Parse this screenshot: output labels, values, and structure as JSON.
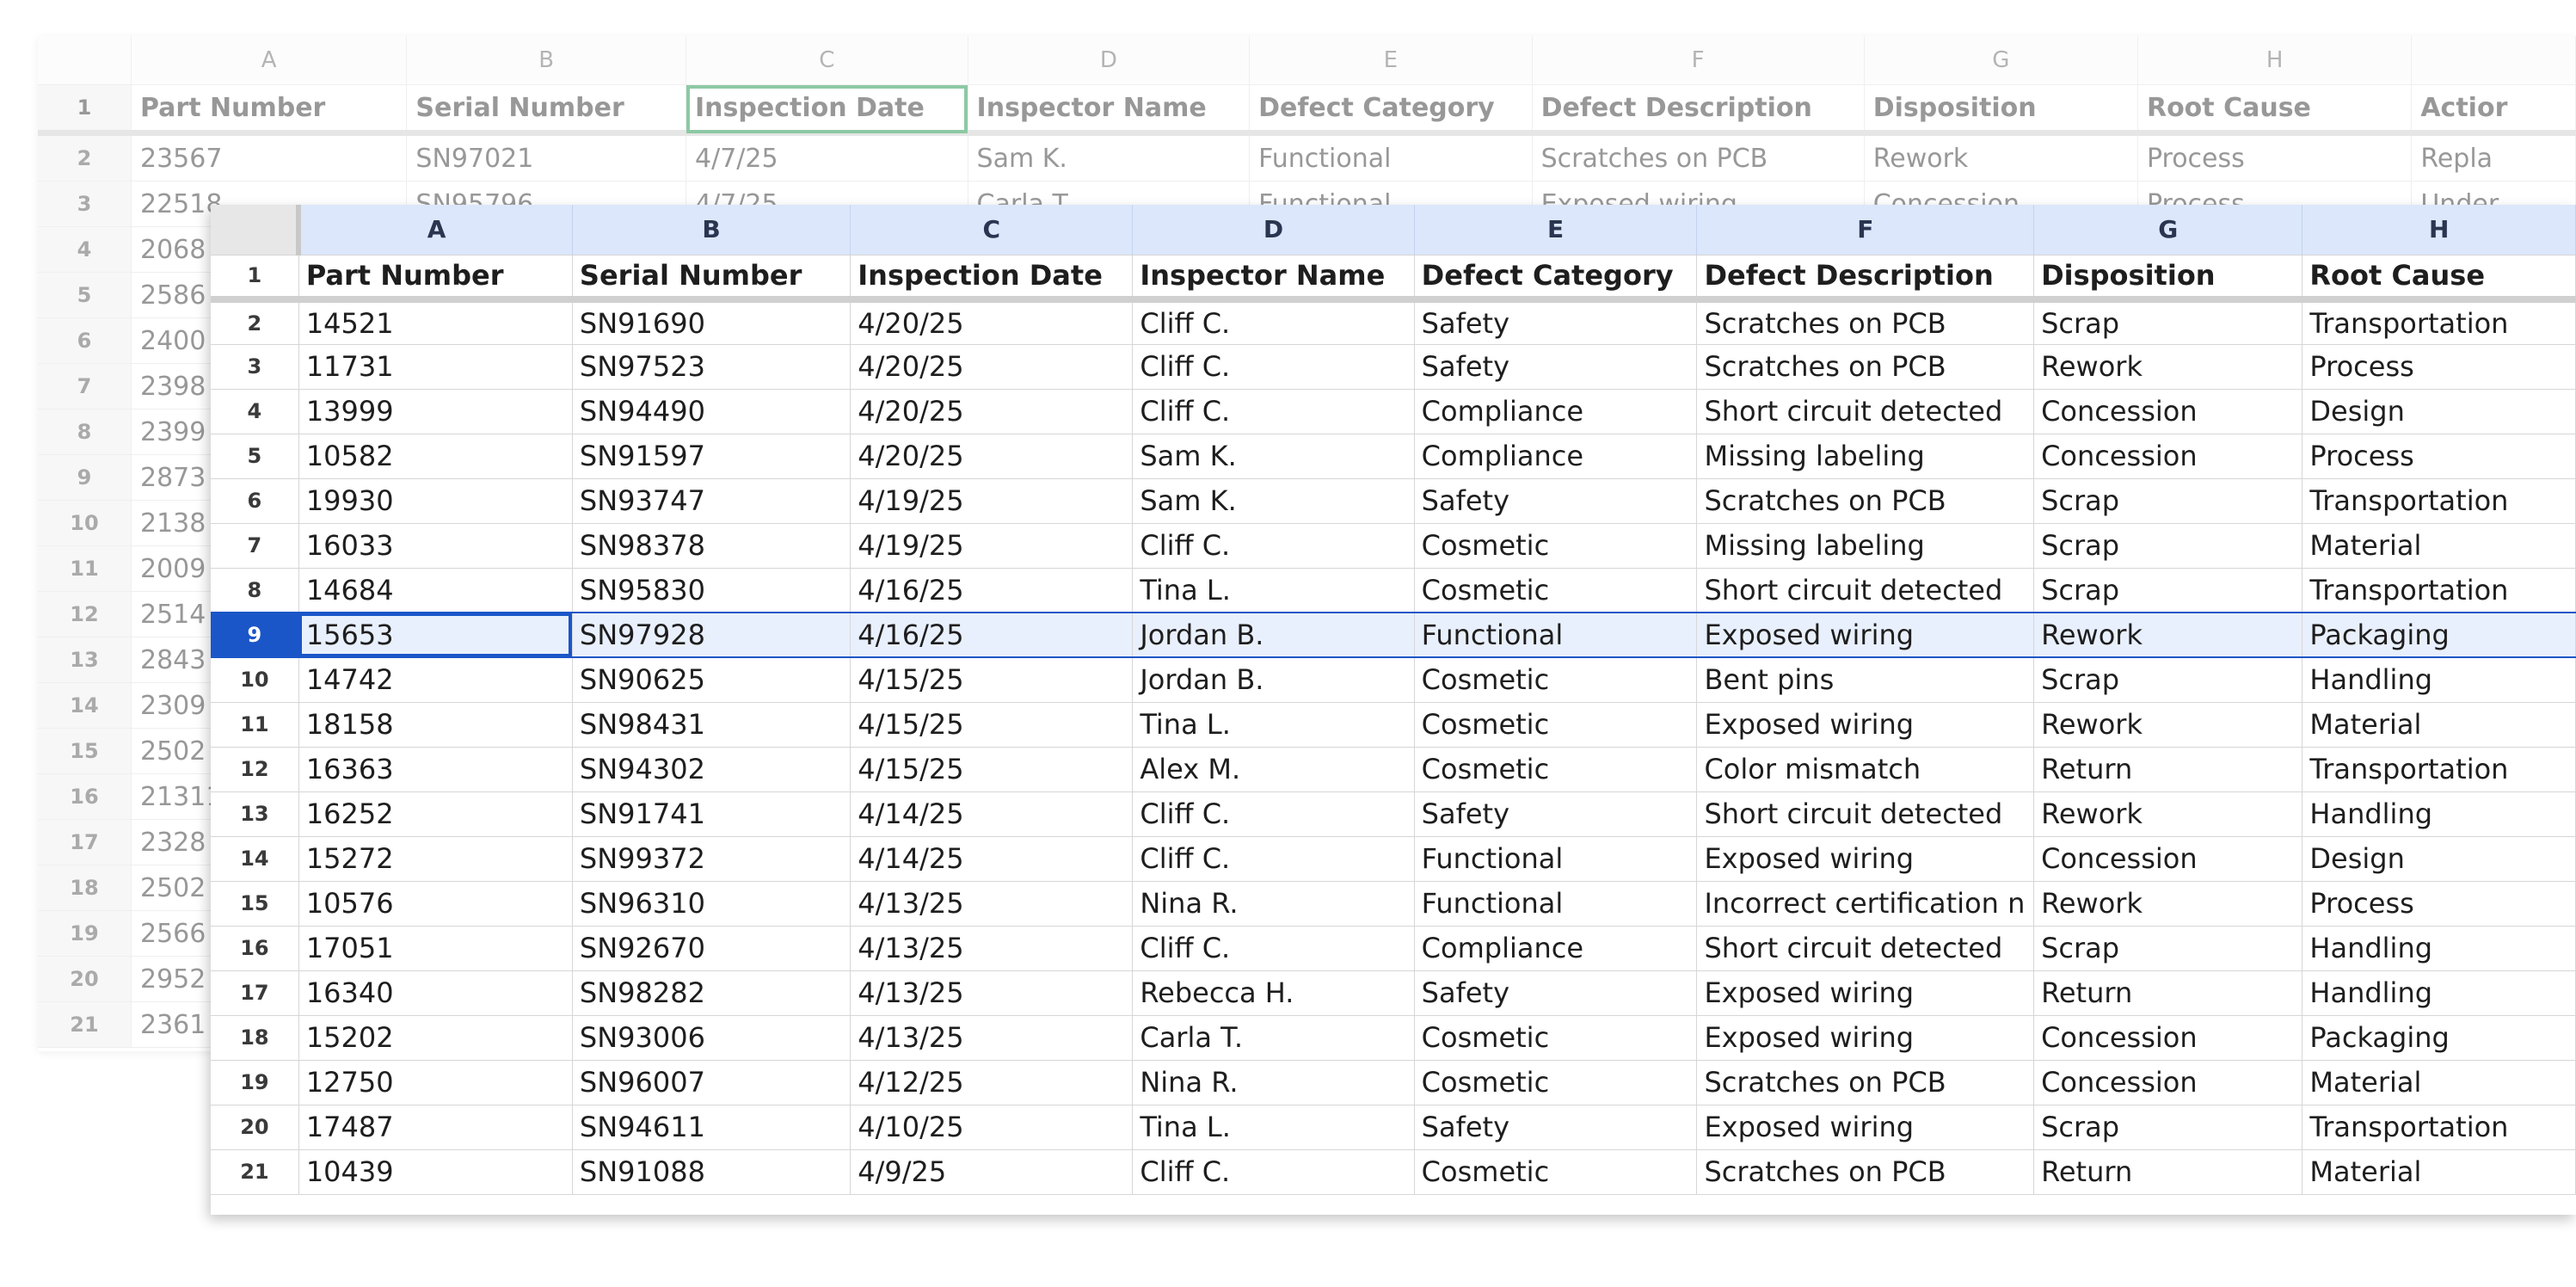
{
  "colors": {
    "selection_blue": "#1a56c8",
    "header_blue": "#dce7fb",
    "bg_selection_green": "#2f9e5a"
  },
  "background_sheet": {
    "col_letters": [
      "A",
      "B",
      "C",
      "D",
      "E",
      "F",
      "G",
      "H",
      ""
    ],
    "headers": [
      "Part Number",
      "Serial Number",
      "Inspection Date",
      "Inspector Name",
      "Defect Category",
      "Defect Description",
      "Disposition",
      "Root Cause",
      "Actior"
    ],
    "row_numbers": [
      "1",
      "2",
      "3",
      "4",
      "5",
      "6",
      "7",
      "8",
      "9",
      "10",
      "11",
      "12",
      "13",
      "14",
      "15",
      "16",
      "17",
      "18",
      "19",
      "20",
      "21"
    ],
    "rows": [
      [
        "23567",
        "SN97021",
        "4/7/25",
        "Sam K.",
        "Functional",
        "Scratches on PCB",
        "Rework",
        "Process",
        "Repla"
      ],
      [
        "22518",
        "SN95796",
        "4/7/25",
        "Carla T.",
        "Functional",
        "Exposed wiring",
        "Concession",
        "Process",
        "Under"
      ],
      [
        "2068",
        "",
        "",
        "",
        "",
        "",
        "",
        "",
        ""
      ],
      [
        "2586",
        "",
        "",
        "",
        "",
        "",
        "",
        "",
        ""
      ],
      [
        "2400",
        "",
        "",
        "",
        "",
        "",
        "",
        "",
        ""
      ],
      [
        "2398",
        "",
        "",
        "",
        "",
        "",
        "",
        "",
        ""
      ],
      [
        "2399",
        "",
        "",
        "",
        "",
        "",
        "",
        "",
        ""
      ],
      [
        "2873",
        "",
        "",
        "",
        "",
        "",
        "",
        "",
        ""
      ],
      [
        "2138",
        "",
        "",
        "",
        "",
        "",
        "",
        "",
        ""
      ],
      [
        "2009",
        "",
        "",
        "",
        "",
        "",
        "",
        "",
        ""
      ],
      [
        "2514",
        "",
        "",
        "",
        "",
        "",
        "",
        "",
        ""
      ],
      [
        "2843",
        "",
        "",
        "",
        "",
        "",
        "",
        "",
        ""
      ],
      [
        "2309",
        "",
        "",
        "",
        "",
        "",
        "",
        "",
        ""
      ],
      [
        "2502",
        "",
        "",
        "",
        "",
        "",
        "",
        "",
        ""
      ],
      [
        "21311",
        "",
        "",
        "",
        "",
        "",
        "",
        "",
        ""
      ],
      [
        "2328",
        "",
        "",
        "",
        "",
        "",
        "",
        "",
        ""
      ],
      [
        "2502",
        "",
        "",
        "",
        "",
        "",
        "",
        "",
        ""
      ],
      [
        "2566",
        "",
        "",
        "",
        "",
        "",
        "",
        "",
        ""
      ],
      [
        "2952",
        "",
        "",
        "",
        "",
        "",
        "",
        "",
        ""
      ],
      [
        "2361",
        "",
        "",
        "",
        "",
        "",
        "",
        "",
        ""
      ]
    ]
  },
  "sheet": {
    "col_letters": [
      "A",
      "B",
      "C",
      "D",
      "E",
      "F",
      "G",
      "H"
    ],
    "headers": [
      "Part Number",
      "Serial Number",
      "Inspection Date",
      "Inspector Name",
      "Defect Category",
      "Defect Description",
      "Disposition",
      "Root Cause"
    ],
    "row_numbers": [
      "1",
      "2",
      "3",
      "4",
      "5",
      "6",
      "7",
      "8",
      "9",
      "10",
      "11",
      "12",
      "13",
      "14",
      "15",
      "16",
      "17",
      "18",
      "19",
      "20",
      "21"
    ],
    "active_row": "9",
    "active_cell": "A9",
    "rows": [
      [
        "14521",
        "SN91690",
        "4/20/25",
        "Cliff C.",
        "Safety",
        "Scratches on PCB",
        "Scrap",
        "Transportation"
      ],
      [
        "11731",
        "SN97523",
        "4/20/25",
        "Cliff C.",
        "Safety",
        "Scratches on PCB",
        "Rework",
        "Process"
      ],
      [
        "13999",
        "SN94490",
        "4/20/25",
        "Cliff C.",
        "Compliance",
        "Short circuit detected",
        "Concession",
        "Design"
      ],
      [
        "10582",
        "SN91597",
        "4/20/25",
        "Sam K.",
        "Compliance",
        "Missing labeling",
        "Concession",
        "Process"
      ],
      [
        "19930",
        "SN93747",
        "4/19/25",
        "Sam K.",
        "Safety",
        "Scratches on PCB",
        "Scrap",
        "Transportation"
      ],
      [
        "16033",
        "SN98378",
        "4/19/25",
        "Cliff C.",
        "Cosmetic",
        "Missing labeling",
        "Scrap",
        "Material"
      ],
      [
        "14684",
        "SN95830",
        "4/16/25",
        "Tina L.",
        "Cosmetic",
        "Short circuit detected",
        "Scrap",
        "Transportation"
      ],
      [
        "15653",
        "SN97928",
        "4/16/25",
        "Jordan B.",
        "Functional",
        "Exposed wiring",
        "Rework",
        "Packaging"
      ],
      [
        "14742",
        "SN90625",
        "4/15/25",
        "Jordan B.",
        "Cosmetic",
        "Bent pins",
        "Scrap",
        "Handling"
      ],
      [
        "18158",
        "SN98431",
        "4/15/25",
        "Tina L.",
        "Cosmetic",
        "Exposed wiring",
        "Rework",
        "Material"
      ],
      [
        "16363",
        "SN94302",
        "4/15/25",
        "Alex M.",
        "Cosmetic",
        "Color mismatch",
        "Return",
        "Transportation"
      ],
      [
        "16252",
        "SN91741",
        "4/14/25",
        "Cliff C.",
        "Safety",
        "Short circuit detected",
        "Rework",
        "Handling"
      ],
      [
        "15272",
        "SN99372",
        "4/14/25",
        "Cliff C.",
        "Functional",
        "Exposed wiring",
        "Concession",
        "Design"
      ],
      [
        "10576",
        "SN96310",
        "4/13/25",
        "Nina R.",
        "Functional",
        "Incorrect certification n",
        "Rework",
        "Process"
      ],
      [
        "17051",
        "SN92670",
        "4/13/25",
        "Cliff C.",
        "Compliance",
        "Short circuit detected",
        "Scrap",
        "Handling"
      ],
      [
        "16340",
        "SN98282",
        "4/13/25",
        "Rebecca H.",
        "Safety",
        "Exposed wiring",
        "Return",
        "Handling"
      ],
      [
        "15202",
        "SN93006",
        "4/13/25",
        "Carla T.",
        "Cosmetic",
        "Exposed wiring",
        "Concession",
        "Packaging"
      ],
      [
        "12750",
        "SN96007",
        "4/12/25",
        "Nina R.",
        "Cosmetic",
        "Scratches on PCB",
        "Concession",
        "Material"
      ],
      [
        "17487",
        "SN94611",
        "4/10/25",
        "Tina L.",
        "Safety",
        "Exposed wiring",
        "Scrap",
        "Transportation"
      ],
      [
        "10439",
        "SN91088",
        "4/9/25",
        "Cliff C.",
        "Cosmetic",
        "Scratches on PCB",
        "Return",
        "Material"
      ]
    ]
  }
}
